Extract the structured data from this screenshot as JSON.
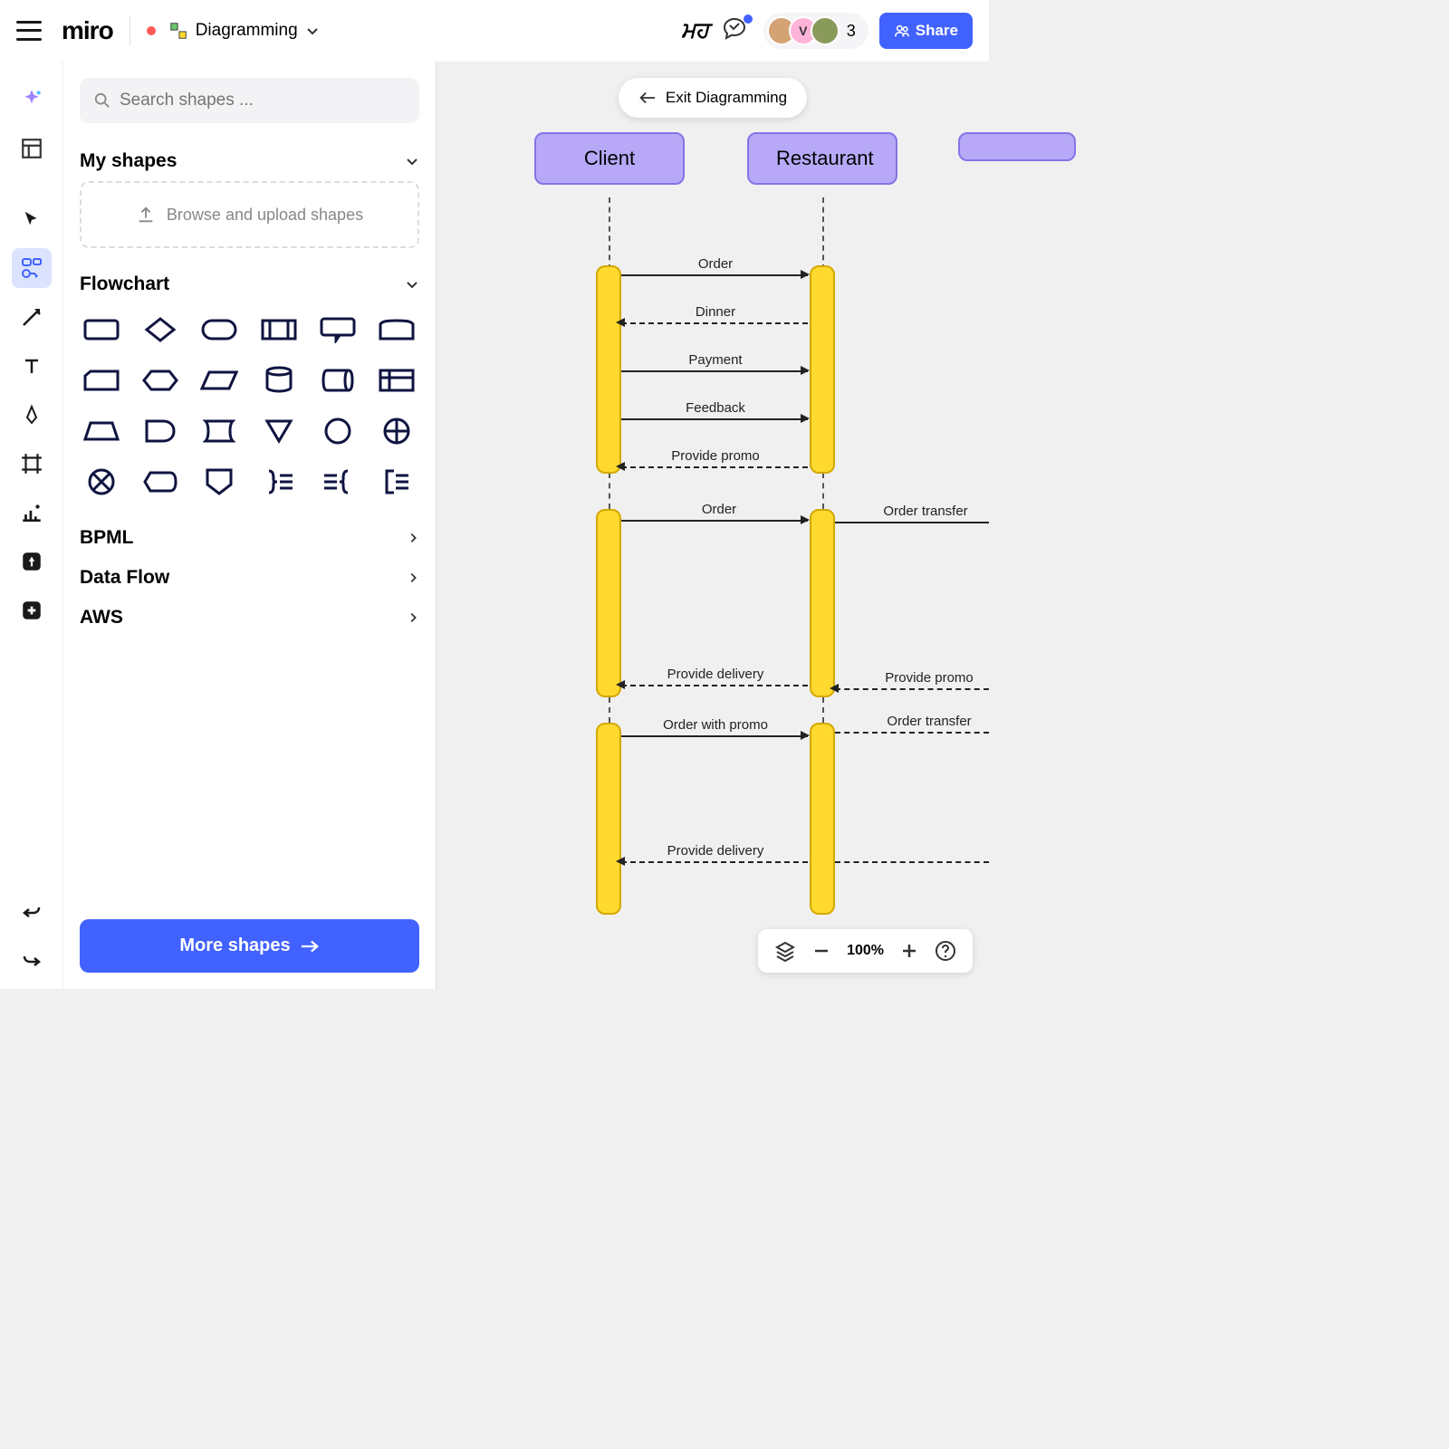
{
  "header": {
    "logo": "miro",
    "mode_label": "Diagramming",
    "avatar_count": "3",
    "share_label": "Share"
  },
  "panel": {
    "search_placeholder": "Search shapes ...",
    "my_shapes_label": "My shapes",
    "upload_label": "Browse and upload shapes",
    "flowchart_label": "Flowchart",
    "bpml_label": "BPML",
    "dataflow_label": "Data Flow",
    "aws_label": "AWS",
    "more_label": "More shapes"
  },
  "canvas": {
    "exit_label": "Exit Diagramming",
    "actors": {
      "client": "Client",
      "restaurant": "Restaurant"
    },
    "messages": {
      "m1": "Order",
      "m2": "Dinner",
      "m3": "Payment",
      "m4": "Feedback",
      "m5": "Provide promo",
      "m6": "Order",
      "m7": "Order transfer",
      "m8": "Provide delivery",
      "m9": "Provide promo",
      "m10": "Order with promo",
      "m11": "Order transfer",
      "m12": "Provide delivery"
    }
  },
  "zoom": {
    "level": "100%"
  }
}
